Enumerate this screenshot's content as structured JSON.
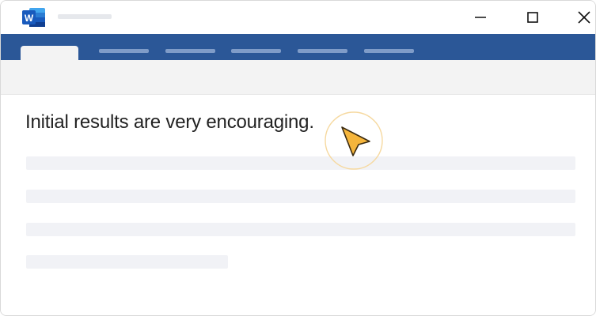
{
  "app": {
    "icon": "word-icon",
    "icon_letter": "W",
    "brand_color": "#2b5797"
  },
  "window_controls": {
    "minimize_icon": "minimize-icon",
    "maximize_icon": "maximize-icon",
    "close_icon": "close-icon"
  },
  "document": {
    "text": "Initial results are very encouraging."
  },
  "cursor": {
    "icon": "pointer-cursor-icon",
    "fill": "#f5b53b",
    "ring": "#f6d9a0"
  }
}
